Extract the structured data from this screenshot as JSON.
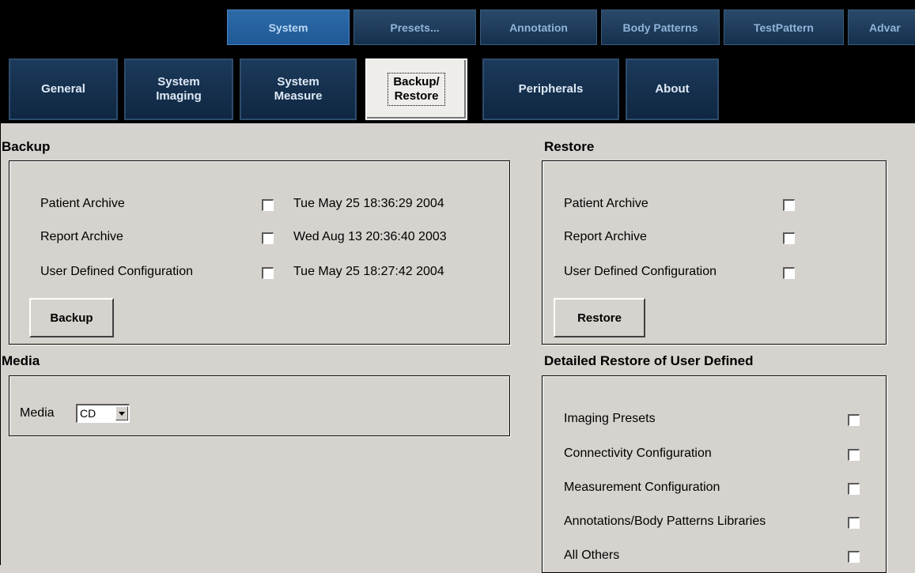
{
  "top_tabs": [
    {
      "label": "System",
      "active": true
    },
    {
      "label": "Presets...",
      "active": false
    },
    {
      "label": "Annotation",
      "active": false
    },
    {
      "label": "Body Patterns",
      "active": false
    },
    {
      "label": "TestPattern",
      "active": false
    },
    {
      "label": "Advar",
      "active": false
    }
  ],
  "sub_tabs": [
    {
      "label": "General",
      "active": false
    },
    {
      "label": "System\nImaging",
      "active": false
    },
    {
      "label": "System\nMeasure",
      "active": false
    },
    {
      "label": "Backup/\nRestore",
      "active": true
    },
    {
      "label": "Peripherals",
      "active": false
    },
    {
      "label": "About",
      "active": false
    }
  ],
  "backup": {
    "title": "Backup",
    "items": [
      {
        "label": "Patient Archive",
        "checked": false,
        "date": "Tue May 25 18:36:29 2004"
      },
      {
        "label": "Report Archive",
        "checked": false,
        "date": "Wed Aug 13 20:36:40 2003"
      },
      {
        "label": "User Defined Configuration",
        "checked": false,
        "date": "Tue May 25 18:27:42 2004"
      }
    ],
    "button_label": "Backup"
  },
  "restore": {
    "title": "Restore",
    "items": [
      {
        "label": "Patient Archive",
        "checked": false
      },
      {
        "label": "Report Archive",
        "checked": false
      },
      {
        "label": "User Defined Configuration",
        "checked": false
      }
    ],
    "button_label": "Restore"
  },
  "media": {
    "title": "Media",
    "label": "Media",
    "selected": "CD"
  },
  "detailed_restore": {
    "title": "Detailed Restore of User Defined",
    "items": [
      {
        "label": "Imaging Presets",
        "checked": false
      },
      {
        "label": "Connectivity Configuration",
        "checked": false
      },
      {
        "label": "Measurement Configuration",
        "checked": false
      },
      {
        "label": "Annotations/Body Patterns Libraries",
        "checked": false
      },
      {
        "label": "All Others",
        "checked": false
      }
    ]
  },
  "colors": {
    "panel_bg": "#d6d3ce",
    "top_bar_bg": "#000000",
    "tab_bg": "#15304d",
    "tab_text": "#8fb3d9",
    "active_tab_bg": "#1f5a96"
  }
}
